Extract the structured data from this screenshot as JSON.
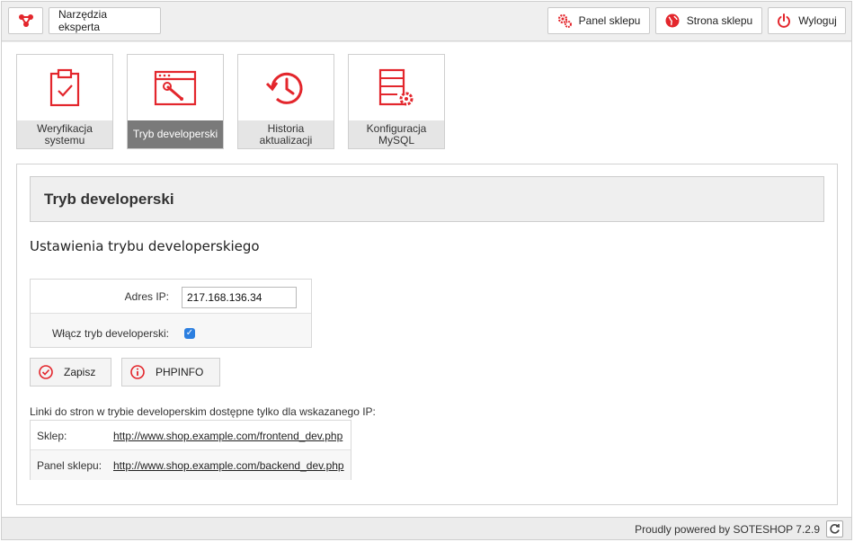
{
  "topbar": {
    "tools_label": "Narzędzia eksperta",
    "panel_label": "Panel sklepu",
    "store_label": "Strona sklepu",
    "logout_label": "Wyloguj"
  },
  "tiles": [
    {
      "label": "Weryfikacja systemu",
      "icon": "clipboard-check-icon",
      "active": false
    },
    {
      "label": "Tryb developerski",
      "icon": "browser-wrench-icon",
      "active": true
    },
    {
      "label": "Historia aktualizacji",
      "icon": "history-clock-icon",
      "active": false
    },
    {
      "label": "Konfiguracja MySQL",
      "icon": "list-gear-icon",
      "active": false
    }
  ],
  "panel": {
    "header": "Tryb developerski",
    "section_title": "Ustawienia trybu developerskiego",
    "form": {
      "ip_label": "Adres IP:",
      "ip_value": "217.168.136.34",
      "dev_label": "Włącz tryb developerski:",
      "dev_checked": true
    },
    "buttons": {
      "save": "Zapisz",
      "phpinfo": "PHPINFO"
    },
    "links_caption": "Linki do stron w trybie developerskim dostępne tylko dla wskazanego IP:",
    "links": [
      {
        "key": "Sklep:",
        "url": "http://www.shop.example.com/frontend_dev.php"
      },
      {
        "key": "Panel sklepu:",
        "url": "http://www.shop.example.com/backend_dev.php"
      }
    ]
  },
  "footer": {
    "text": "Proudly powered by SOTESHOP 7.2.9"
  },
  "colors": {
    "accent": "#e3262c",
    "active_tile": "#7a7a7a",
    "checkbox": "#2c7fe0"
  }
}
